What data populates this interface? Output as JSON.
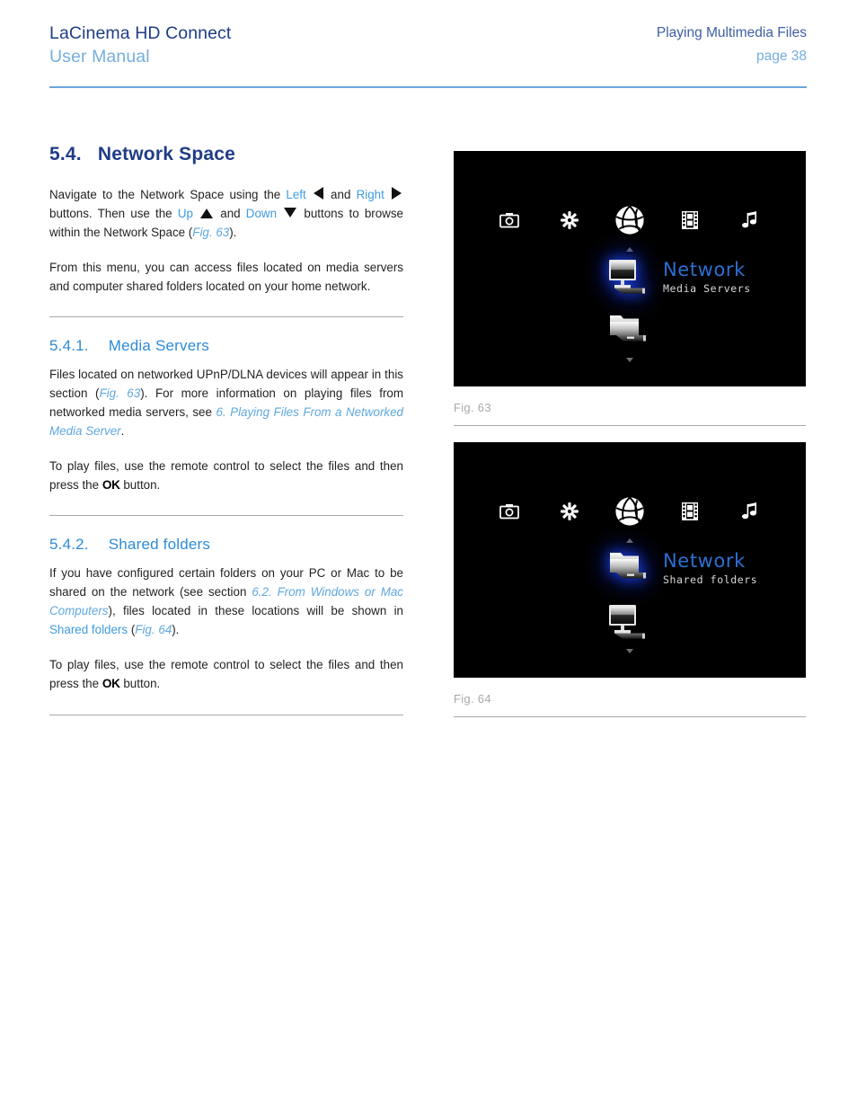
{
  "header": {
    "product": "LaCinema HD Connect",
    "doc_type": "User Manual",
    "section": "Playing Multimedia Files",
    "page": "page 38"
  },
  "section": {
    "number": "5.4.",
    "title": "Network Space",
    "paragraph_1": {
      "pre": "Navigate to the Network Space using the ",
      "left_label": "Left",
      "mid_and": " and ",
      "right_label": "Right",
      "post_1": " buttons.  Then use the ",
      "up_label": "Up",
      "and_2": " and ",
      "down_label": "Down",
      "post_2": " buttons to browse within the Network Space (",
      "fig_ref": "Fig. 63",
      "post_3": ")."
    },
    "paragraph_2": "From this menu, you can access files located on media servers and computer shared folders located on your home network."
  },
  "subsection_media_servers": {
    "number": "5.4.1.",
    "title": "Media Servers",
    "paragraph_1": {
      "pre": "Files located on networked UPnP/DLNA devices will appear in this section (",
      "fig_ref": "Fig. 63",
      "mid": ").  For more information on playing files from networked media servers, see ",
      "link": "6. Playing Files From a Networked Media Server",
      "post": "."
    },
    "paragraph_2": {
      "pre": "To play files, use the remote control to select the files and then press the ",
      "ok": "OK",
      "post": " button."
    }
  },
  "subsection_shared_folders": {
    "number": "5.4.2.",
    "title": "Shared folders",
    "paragraph_1": {
      "pre": "If you have configured certain folders on your PC or Mac to be shared on the network (see section ",
      "link_section": "6.2. From Windows or Mac Computers",
      "mid": "), files located in these locations will be shown in ",
      "link_shared": "Shared folders",
      "mid_2": " (",
      "fig_ref": "Fig. 64",
      "post": ")."
    },
    "paragraph_2": {
      "pre": "To play files, use the remote control to select the files and then press the ",
      "ok": "OK",
      "post": " button."
    }
  },
  "figures": [
    {
      "caption": "Fig. 63",
      "ui": {
        "top_icons": [
          "camera-icon",
          "gear-icon",
          "network-globe-icon",
          "film-icon",
          "music-note-icon"
        ],
        "active_icon": "network-globe-icon",
        "selected_row": {
          "icon": "monitor-icon",
          "title": "Network",
          "subtitle": "Media Servers"
        },
        "next_row_icon": "folder-icon"
      }
    },
    {
      "caption": "Fig. 64",
      "ui": {
        "top_icons": [
          "camera-icon",
          "gear-icon",
          "network-globe-icon",
          "film-icon",
          "music-note-icon"
        ],
        "active_icon": "network-globe-icon",
        "selected_row": {
          "icon": "folder-icon",
          "title": "Network",
          "subtitle": "Shared folders"
        },
        "next_row_icon": "monitor-icon"
      }
    }
  ],
  "colors": {
    "navy": "#1F3C87",
    "light_blue": "#76AEDE",
    "link_blue": "#3E9BDD",
    "heading_blue": "#2E8BD6",
    "rule_blue": "#6CA6DC",
    "rule_gray": "#A7A9AC",
    "screen_bg": "#000000",
    "screen_accent": "#2C6FD4"
  }
}
